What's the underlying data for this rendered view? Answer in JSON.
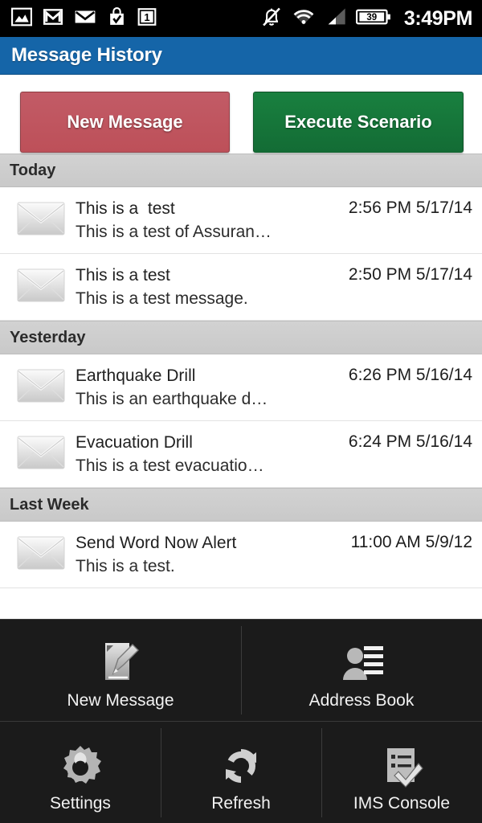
{
  "statusbar": {
    "time": "3:49PM",
    "battery_level": "39",
    "left_icons": [
      {
        "name": "gallery-icon"
      },
      {
        "name": "gmail-icon"
      },
      {
        "name": "email-icon"
      },
      {
        "name": "play-store-icon"
      },
      {
        "name": "calendar-icon"
      }
    ],
    "right_icons": [
      {
        "name": "silent-bell-icon"
      },
      {
        "name": "wifi-icon"
      },
      {
        "name": "cell-signal-icon"
      },
      {
        "name": "battery-icon"
      }
    ]
  },
  "header": {
    "title": "Message History"
  },
  "actions": {
    "new_message_label": "New Message",
    "execute_scenario_label": "Execute Scenario",
    "new_message_color": "#c25b66",
    "execute_scenario_color": "#19803f"
  },
  "sections": [
    {
      "title": "Today",
      "messages": [
        {
          "subject": "This is a  test",
          "preview": "This is a test of Assuran…",
          "stamp": "2:56 PM 5/17/14"
        },
        {
          "subject": "This is a test",
          "preview": "This is a test message.",
          "stamp": "2:50 PM 5/17/14"
        }
      ]
    },
    {
      "title": "Yesterday",
      "messages": [
        {
          "subject": "Earthquake Drill",
          "preview": "This is an earthquake d…",
          "stamp": "6:26 PM 5/16/14"
        },
        {
          "subject": "Evacuation Drill",
          "preview": "This is a test evacuatio…",
          "stamp": "6:24 PM 5/16/14"
        }
      ]
    },
    {
      "title": "Last Week",
      "messages": [
        {
          "subject": "Send Word Now Alert",
          "preview": "This is a test.",
          "stamp": "11:00 AM 5/9/12"
        }
      ]
    }
  ],
  "menu": {
    "items": [
      {
        "label": "New Message",
        "icon": "compose-icon"
      },
      {
        "label": "Address Book",
        "icon": "contacts-icon"
      },
      {
        "label": "Settings",
        "icon": "gear-icon"
      },
      {
        "label": "Refresh",
        "icon": "refresh-icon"
      },
      {
        "label": "IMS Console",
        "icon": "checklist-icon"
      }
    ]
  }
}
